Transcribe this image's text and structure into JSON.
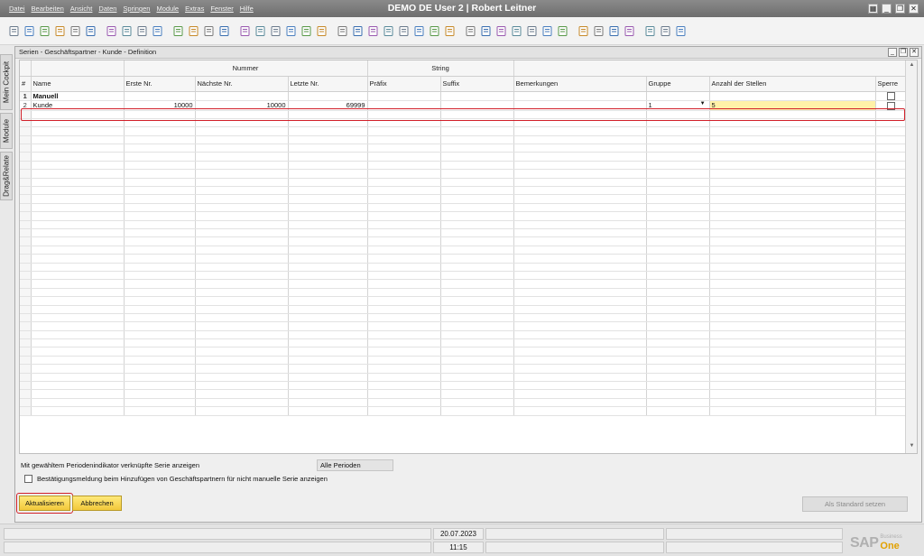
{
  "app": {
    "title": "DEMO DE User 2 | Robert Leitner",
    "menu": [
      "Datei",
      "Bearbeiten",
      "Ansicht",
      "Daten",
      "Springen",
      "Module",
      "Extras",
      "Fenster",
      "Hilfe"
    ]
  },
  "toolbar": {
    "icons": [
      "new-doc-icon",
      "print-icon",
      "preview-icon",
      "email-icon",
      "export-icon",
      "save-icon",
      "excel-icon",
      "word-icon",
      "pdf-icon",
      "lock-icon",
      "refresh-icon",
      "find-icon",
      "copy-icon",
      "first-record-icon",
      "previous-record-icon",
      "next-record-icon",
      "last-record-icon",
      "filter-icon",
      "sort-icon",
      "base-doc-icon",
      "target-doc-icon",
      "duplicate-icon",
      "journal-icon",
      "hand-icon",
      "chart-icon",
      "report-icon",
      "attach-icon",
      "edit-icon",
      "pen-icon",
      "history-icon",
      "message-icon",
      "chat-icon",
      "calendar-icon",
      "alert-icon",
      "settings-icon",
      "user-icon",
      "org-icon",
      "export-doc-icon",
      "web-icon",
      "help-icon",
      "db-icon",
      "form-icon"
    ]
  },
  "sidetabs": [
    "Mein Cockpit",
    "Module",
    "Drag&Relate"
  ],
  "window": {
    "title": "Serien - Geschäftspartner - Kunde - Definition"
  },
  "grid": {
    "group_headers": {
      "nummer": "Nummer",
      "string": "String"
    },
    "columns": [
      "#",
      "Name",
      "Erste Nr.",
      "Nächste Nr.",
      "Letzte Nr.",
      "Präfix",
      "Suffix",
      "Bemerkungen",
      "Gruppe",
      "Anzahl der Stellen",
      "Sperre"
    ],
    "rows": [
      {
        "num": "1",
        "name": "Manuell",
        "first": "",
        "next": "",
        "last": "",
        "prefix": "",
        "suffix": "",
        "remarks": "",
        "group": "",
        "digits": "",
        "locked": false
      },
      {
        "num": "2",
        "name": "Kunde",
        "first": "10000",
        "next": "10000",
        "last": "69999",
        "prefix": "",
        "suffix": "",
        "remarks": "",
        "group": "1",
        "digits": "5",
        "locked": false
      }
    ]
  },
  "options": {
    "period_label": "Mit gewähltem Periodenindikator verknüpfte Serie anzeigen",
    "period_value": "Alle Perioden",
    "confirm_label": "Bestätigungsmeldung beim Hinzufügen von Geschäftspartnern für nicht manuelle Serie anzeigen",
    "confirm_checked": false
  },
  "buttons": {
    "update": "Aktualisieren",
    "cancel": "Abbrechen",
    "set_default": "Als Standard setzen"
  },
  "status": {
    "date": "20.07.2023",
    "time": "11:15"
  },
  "brand": {
    "sap": "SAP",
    "business": "Business",
    "one": "One"
  }
}
